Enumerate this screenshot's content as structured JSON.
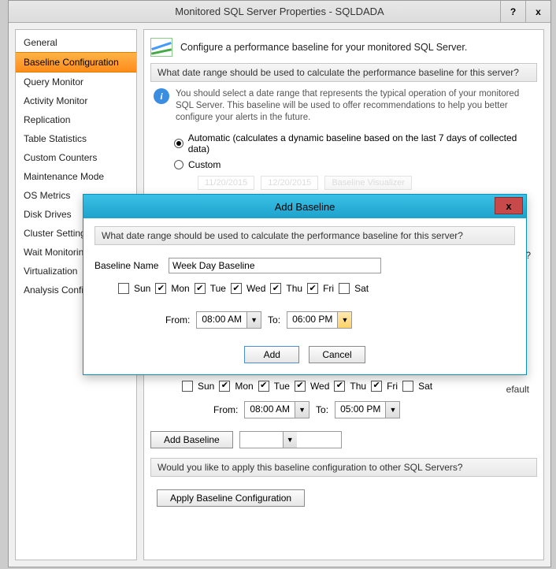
{
  "window": {
    "title": "Monitored SQL Server Properties - SQLDADA",
    "help": "?",
    "close": "x"
  },
  "sidebar": {
    "items": [
      "General",
      "Baseline Configuration",
      "Query Monitor",
      "Activity Monitor",
      "Replication",
      "Table Statistics",
      "Custom Counters",
      "Maintenance Mode",
      "OS Metrics",
      "Disk Drives",
      "Cluster Settings",
      "Wait Monitoring",
      "Virtualization",
      "Analysis Configuration"
    ],
    "selected_index": 1
  },
  "content": {
    "heading": "Configure a performance baseline for your monitored SQL Server.",
    "section1_title": "What date range should be used to calculate the performance baseline for this server?",
    "info_text": "You should select a date range that represents the typical operation of your monitored SQL Server. This baseline will be used to offer recommendations to help you better configure your alerts in the future.",
    "radio_auto": "Automatic (calculates a dynamic baseline based on the last 7 days of collected data)",
    "radio_custom": "Custom",
    "date_from_hint": "11/20/2015",
    "date_to_hint": "12/20/2015",
    "ghost_button": "Baseline Visualizer",
    "peek_question_suffix": "e?",
    "peek_default_suffix": "efault",
    "baseline_name_label": "Baseline Name",
    "lower": {
      "days_labels": [
        "Sun",
        "Mon",
        "Tue",
        "Wed",
        "Thu",
        "Fri",
        "Sat"
      ],
      "days_checked": [
        false,
        true,
        true,
        true,
        true,
        true,
        false
      ],
      "from_label": "From:",
      "to_label": "To:",
      "from_time": "08:00 AM",
      "to_time": "05:00 PM",
      "add_baseline_btn": "Add Baseline",
      "apply_section": "Would you like to apply this baseline configuration to other SQL Servers?",
      "apply_btn": "Apply Baseline Configuration"
    }
  },
  "dialog": {
    "title": "Add Baseline",
    "close": "x",
    "section_title": "What date range should be used to calculate the performance baseline for this server?",
    "name_label": "Baseline Name",
    "name_value": "Week Day Baseline",
    "days_labels": [
      "Sun",
      "Mon",
      "Tue",
      "Wed",
      "Thu",
      "Fri",
      "Sat"
    ],
    "days_checked": [
      false,
      true,
      true,
      true,
      true,
      true,
      false
    ],
    "from_label": "From:",
    "to_label": "To:",
    "from_time": "08:00 AM",
    "to_time": "06:00 PM",
    "btn_add": "Add",
    "btn_cancel": "Cancel"
  }
}
